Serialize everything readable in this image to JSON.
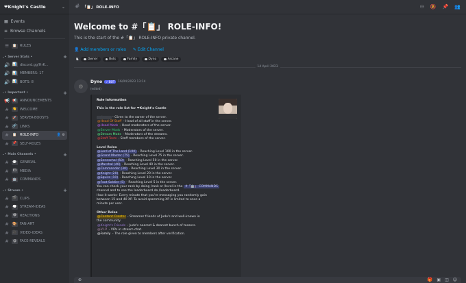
{
  "server": {
    "name": "❤Knight's Castle"
  },
  "nav": {
    "events": "Events",
    "browse": "Browse Channels"
  },
  "sidebar": {
    "top_channels": [
      {
        "icon": "☰",
        "emoji": "📋",
        "name": "RULES"
      }
    ],
    "categories": [
      {
        "name": "• Server Stats •",
        "channels": [
          {
            "icon": "🔊",
            "emoji": "📊",
            "name": "discord.gg/HrK..."
          },
          {
            "icon": "🔊",
            "emoji": "📊",
            "name": "MEMBERS: 17"
          },
          {
            "icon": "🔊",
            "emoji": "📊",
            "name": "BOTS: 8"
          }
        ]
      },
      {
        "name": "• Important •",
        "channels": [
          {
            "icon": "📢",
            "emoji": "📢",
            "name": "ANNOUNCEMENTS"
          },
          {
            "icon": "#",
            "emoji": "👋",
            "name": "WELCOME"
          },
          {
            "icon": "#",
            "emoji": "🚀",
            "name": "SERVER-BOOSTS"
          },
          {
            "icon": "#",
            "emoji": "🔗",
            "name": "LINKS"
          },
          {
            "icon": "#",
            "emoji": "📋",
            "name": "ROLE-INFO",
            "active": true
          },
          {
            "icon": "#",
            "emoji": "📌",
            "name": "SELF-ROLES"
          }
        ]
      },
      {
        "name": "• Main Channels •",
        "channels": [
          {
            "icon": "#",
            "emoji": "💬",
            "name": "GENERAL"
          },
          {
            "icon": "#",
            "emoji": "🎞",
            "name": "MEDIA"
          },
          {
            "icon": "#",
            "emoji": "🤖",
            "name": "COMMANDS"
          }
        ]
      },
      {
        "name": "• Stream •",
        "channels": [
          {
            "icon": "#",
            "emoji": "🎬",
            "name": "CLIPS"
          },
          {
            "icon": "#",
            "emoji": "💭",
            "name": "STREAM-IDEAS"
          },
          {
            "icon": "#",
            "emoji": "😂",
            "name": "REACTIONS"
          },
          {
            "icon": "#",
            "emoji": "🎨",
            "name": "FAN-ART"
          },
          {
            "icon": "#",
            "emoji": "🎥",
            "name": "VIDEO-IDEAS"
          },
          {
            "icon": "#",
            "emoji": "😃",
            "name": "FACE-REVEALS"
          }
        ]
      }
    ]
  },
  "header": {
    "channel_title": "「📋」 ROLE-INFO"
  },
  "welcome": {
    "title": "Welcome to #「📋」 ROLE-INFO!",
    "subtitle": "This is the start of the #「📋」 ROLE-INFO private channel.",
    "add_members": "Add members or roles",
    "edit_channel": "Edit Channel",
    "roles": [
      "Owner",
      "Bots",
      "Family",
      "Dyno",
      "Arcane"
    ]
  },
  "date_divider": "14 April 2023",
  "message": {
    "author": "Dyno",
    "bot_tag": "✓ BOT",
    "timestamp": "16/04/2023 13:14",
    "edited": "(edited)",
    "embed": {
      "title": "Role Information",
      "intro": "This is the role list for ❤Knight's Castle",
      "staff": [
        {
          "role": "@Owner",
          "text": " - Given to the owner of the server.",
          "cls": "owner"
        },
        {
          "role": "@Head Of Staff",
          "text": " - Head of all staff in the server.",
          "cls": "c-staff"
        },
        {
          "role": "@Head Mods",
          "text": " - Head moderators of the server.",
          "cls": "c-head"
        },
        {
          "role": "@Server Mods",
          "text": " - Moderators of the server.",
          "cls": "c-srv"
        },
        {
          "role": "@Stream Mods",
          "text": " - Moderators of the streams.",
          "cls": "c-strm"
        },
        {
          "role": "@Staff Tests",
          "text": " - Staff members of the server.",
          "cls": "c-stest"
        }
      ],
      "levels_title": "Level Roles",
      "levels": [
        {
          "role": "@Lord of The Land (100)",
          "text": " - Reaching Level 100 in the server."
        },
        {
          "role": "@Grand Master (75)",
          "text": " - Reaching Level 75 in the server."
        },
        {
          "role": "@Seneschal (50)",
          "text": " - Reaching Level 50 in the server."
        },
        {
          "role": "@Marshal (40)",
          "text": " - Reaching Level 40 in the server."
        },
        {
          "role": "@Commander (30)",
          "text": " - Reaching Level 30 in the server."
        },
        {
          "role": "@Knight (20)",
          "text": " - Reaching Level 20 in the server."
        },
        {
          "role": "@Squire (10)",
          "text": " - Reaching Level 10 in the server."
        },
        {
          "role": "@Foot Soldier (5)",
          "text": " - Reaching Level 5 in the server."
        }
      ],
      "rank_pre": "You can check your rank by doing /rank or /level in the ",
      "rank_channel": "#「🤖」 COMMANDS",
      "rank_post": " channel and to see the leaderboard do /leaderboard.",
      "how_1": "How it works- Every minute that you're messaging you randomly gain",
      "how_2": "between 15 and 40 XP. To avoid spamming XP is limited to once a",
      "how_3": "minute per user.",
      "other_title": "Other Roles",
      "others": [
        {
          "role": "@Content Creator",
          "text": " - Streamer friends of Jude's and well-known in",
          "cls": "c-cc"
        },
        {
          "role": "",
          "text": "the community.",
          "cls": ""
        },
        {
          "role": "@Knight's Friends",
          "text": " - Jude's nearest & dearest bunch of tossers.",
          "cls": "c-kf"
        },
        {
          "role": "@V.I.P",
          "text": " - VIPs in stream chat.",
          "cls": "c-vip"
        },
        {
          "role": "@Family",
          "text": " - The role given to members after verification.",
          "cls": "c-fam"
        }
      ]
    }
  },
  "colors": {
    "accent": "#5865f2",
    "link": "#00a8fc",
    "background": "#313338",
    "sidebar": "#2b2d31"
  }
}
